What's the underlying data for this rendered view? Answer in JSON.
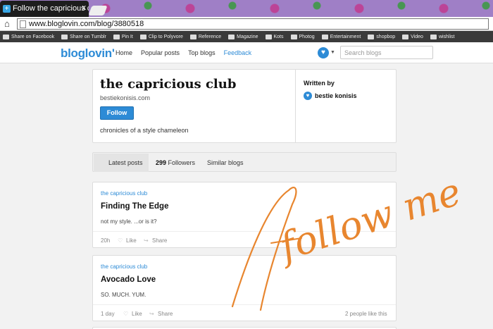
{
  "browser": {
    "tab_title": "Follow the capricious club",
    "tab_close": "x",
    "url": "www.bloglovin.com/blog/3880518",
    "bookmarks": [
      {
        "label": "Share on Facebook"
      },
      {
        "label": "Share on Tumblr"
      },
      {
        "label": "Pin It"
      },
      {
        "label": "Clip to Polyvore"
      },
      {
        "label": "Reference"
      },
      {
        "label": "Magazine"
      },
      {
        "label": "Kots"
      },
      {
        "label": "Photog"
      },
      {
        "label": "Entertainment"
      },
      {
        "label": "shopbop"
      },
      {
        "label": "Video"
      },
      {
        "label": "wishlist"
      }
    ]
  },
  "site": {
    "logo": "bloglovin'",
    "nav": [
      "Home",
      "Popular posts",
      "Top blogs",
      "Feedback"
    ],
    "search_placeholder": "Search blogs"
  },
  "profile": {
    "title": "the capricious club",
    "url": "bestiekonisis.com",
    "follow_label": "Follow",
    "description": "chronicles of a style chameleon",
    "written_by_label": "Written by",
    "author": "bestie konisis"
  },
  "tabs": {
    "latest": "Latest posts",
    "followers_count": "299",
    "followers_label": "Followers",
    "similar": "Similar blogs"
  },
  "posts": [
    {
      "source": "the capricious club",
      "title": "Finding The Edge",
      "excerpt": "not my style. ...or is it?",
      "age": "20h",
      "like": "Like",
      "share": "Share",
      "likes_text": ""
    },
    {
      "source": "the capricious club",
      "title": "Avocado Love",
      "excerpt": "SO. MUCH. YUM.",
      "age": "1 day",
      "like": "Like",
      "share": "Share",
      "likes_text": "2 people like this"
    }
  ],
  "overlay_text": "follow me!",
  "colors": {
    "accent": "#2d8bd6",
    "handwriting": "#e8862f"
  }
}
